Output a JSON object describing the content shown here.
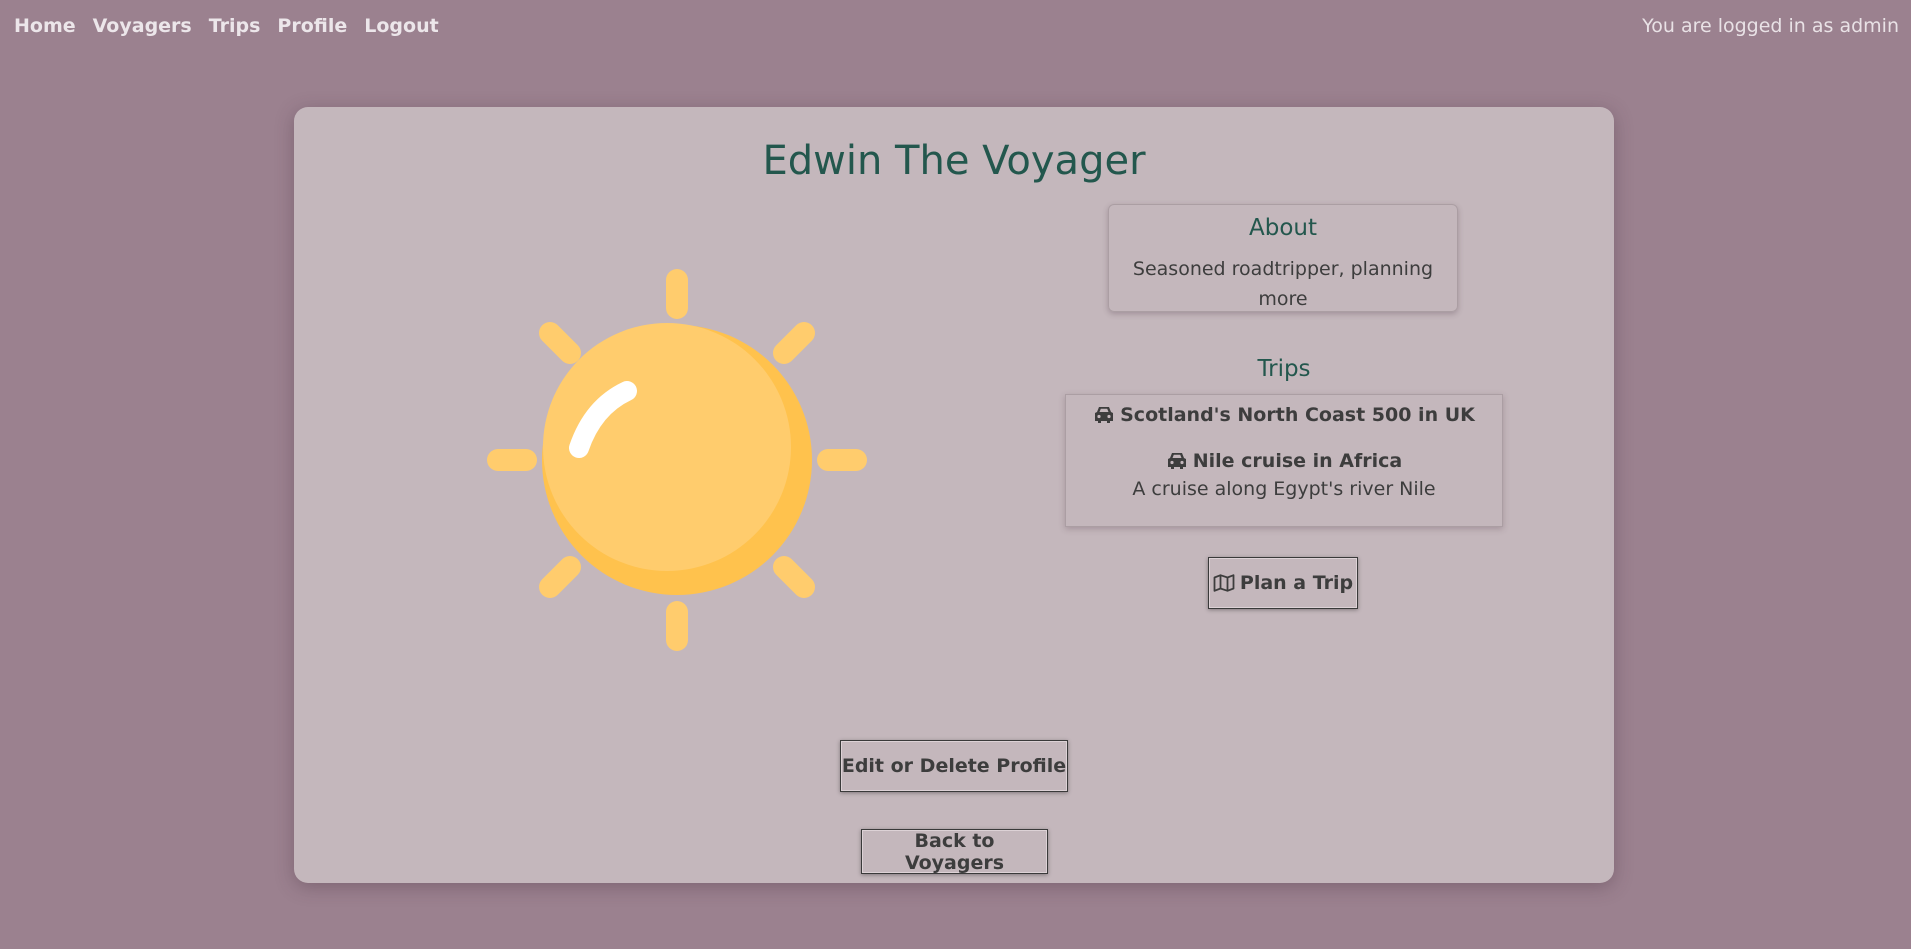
{
  "nav": {
    "links": [
      "Home",
      "Voyagers",
      "Trips",
      "Profile",
      "Logout"
    ],
    "login_status": "You are logged in as admin"
  },
  "profile": {
    "name": "Edwin The Voyager",
    "avatar_icon": "sun-icon",
    "about_title": "About",
    "about_text": "Seasoned roadtripper, planning more"
  },
  "trips": {
    "heading": "Trips",
    "items": [
      {
        "icon": "car-icon",
        "title": "Scotland's North Coast 500 in UK",
        "description": ""
      },
      {
        "icon": "car-icon",
        "title": "Nile cruise in Africa",
        "description": "A cruise along Egypt's river Nile"
      }
    ]
  },
  "buttons": {
    "plan_trip": "Plan a Trip",
    "plan_trip_icon": "map-icon",
    "edit_profile": "Edit or Delete Profile",
    "back": "Back to Voyagers"
  },
  "colors": {
    "background": "#9b818f",
    "card": "#c4b7bc",
    "heading": "#23574d",
    "sun": "#ffcc6d",
    "sun_shade": "#ffc24d"
  }
}
